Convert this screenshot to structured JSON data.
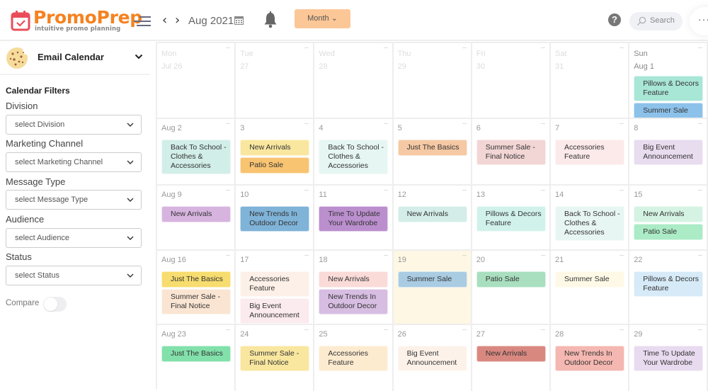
{
  "app": {
    "logo_title": "PromoPrep",
    "logo_subtitle": "intuitive promo planning",
    "brand_color": "#f5821f"
  },
  "header": {
    "current_month": "Aug 2021",
    "view_button": "Month ⌄",
    "search_label": "Search",
    "more_label": "···",
    "help_label": "?"
  },
  "sidebar": {
    "calendar_name": "Email Calendar",
    "filters_title": "Calendar Filters",
    "filters": [
      {
        "label": "Division",
        "placeholder": "select Division"
      },
      {
        "label": "Marketing Channel",
        "placeholder": "select Marketing Channel"
      },
      {
        "label": "Message Type",
        "placeholder": "select Message Type"
      },
      {
        "label": "Audience",
        "placeholder": "select Audience"
      },
      {
        "label": "Status",
        "placeholder": "select Status"
      }
    ],
    "compare_label": "Compare",
    "compare_on": false
  },
  "calendar": {
    "weeks": [
      {
        "days": [
          {
            "label": "Mon\nJul 26",
            "faded": true,
            "events": []
          },
          {
            "label": "Tue\n27",
            "faded": true,
            "events": []
          },
          {
            "label": "Wed\n28",
            "faded": true,
            "events": []
          },
          {
            "label": "Thu\n29",
            "faded": true,
            "events": []
          },
          {
            "label": "Fri\n30",
            "faded": true,
            "events": []
          },
          {
            "label": "Sat\n31",
            "faded": true,
            "events": []
          },
          {
            "label": "Sun\nAug 1",
            "faded": false,
            "events": [
              {
                "title": "Pillows & Decors Feature",
                "color": "#a8e6d6"
              },
              {
                "title": "Summer Sale",
                "color": "#8cc1ea"
              }
            ]
          }
        ]
      },
      {
        "days": [
          {
            "label": "Aug 2",
            "events": [
              {
                "title": "Back To School - Clothes & Accessories",
                "color": "#d2eee8"
              }
            ]
          },
          {
            "label": "3",
            "events": [
              {
                "title": "New Arrivals",
                "color": "#f9e79f"
              },
              {
                "title": "Patio Sale",
                "color": "#f8c471"
              }
            ]
          },
          {
            "label": "4",
            "events": [
              {
                "title": "Back To School - Clothes & Accessories",
                "color": "#e6f6f3"
              }
            ]
          },
          {
            "label": "5",
            "events": [
              {
                "title": "Just The Basics",
                "color": "#f5c9a4"
              }
            ]
          },
          {
            "label": "6",
            "events": [
              {
                "title": "Summer Sale - Final Notice",
                "color": "#f2d5d5"
              }
            ]
          },
          {
            "label": "7",
            "events": [
              {
                "title": "Accessories Feature",
                "color": "#fce9e9"
              }
            ]
          },
          {
            "label": "8",
            "events": [
              {
                "title": "Big Event Announcement",
                "color": "#e8dcef"
              }
            ]
          }
        ]
      },
      {
        "days": [
          {
            "label": "Aug 9",
            "events": [
              {
                "title": "New Arrivals",
                "color": "#d7b4e0"
              }
            ]
          },
          {
            "label": "10",
            "events": [
              {
                "title": "New Trends In Outdoor Decor",
                "color": "#7fb3d8"
              }
            ]
          },
          {
            "label": "11",
            "events": [
              {
                "title": "Time To Update Your Wardrobe",
                "color": "#bb8fce"
              }
            ]
          },
          {
            "label": "12",
            "events": [
              {
                "title": "New Arrivals",
                "color": "#d4ede8"
              }
            ]
          },
          {
            "label": "13",
            "events": [
              {
                "title": "Pillows & Decors Feature",
                "color": "#d1f2eb"
              }
            ]
          },
          {
            "label": "14",
            "events": [
              {
                "title": "Back To School - Clothes & Accessories",
                "color": "#e8f6f3"
              }
            ]
          },
          {
            "label": "15",
            "events": [
              {
                "title": "New Arrivals",
                "color": "#d5f3e3"
              },
              {
                "title": "Patio Sale",
                "color": "#abebc6"
              }
            ]
          }
        ]
      },
      {
        "days": [
          {
            "label": "Aug 16",
            "events": [
              {
                "title": "Just The Basics",
                "color": "#f7dc6f"
              },
              {
                "title": "Summer Sale - Final Notice",
                "color": "#fae5d3"
              }
            ]
          },
          {
            "label": "17",
            "events": [
              {
                "title": "Accessories Feature",
                "color": "#fdf0e8"
              },
              {
                "title": "Big Event Announcement",
                "color": "#fbeaee"
              }
            ]
          },
          {
            "label": "18",
            "events": [
              {
                "title": "New Arrivals",
                "color": "#fadbd8"
              },
              {
                "title": "New Trends In Outdoor Decor",
                "color": "#d7bde2"
              }
            ]
          },
          {
            "label": "19",
            "today": true,
            "events": [
              {
                "title": "Summer Sale",
                "color": "#a9cce3"
              }
            ]
          },
          {
            "label": "20",
            "events": [
              {
                "title": "Patio Sale",
                "color": "#a9dfbf"
              }
            ]
          },
          {
            "label": "21",
            "events": [
              {
                "title": "Summer Sale",
                "color": "#fef9e7"
              }
            ]
          },
          {
            "label": "22",
            "events": [
              {
                "title": "Pillows & Decors Feature",
                "color": "#d6eaf8"
              }
            ]
          }
        ]
      },
      {
        "days": [
          {
            "label": "Aug 23",
            "events": [
              {
                "title": "Just The Basics",
                "color": "#82e0aa"
              }
            ]
          },
          {
            "label": "24",
            "events": [
              {
                "title": "Summer Sale - Final Notice",
                "color": "#f9e79f"
              }
            ]
          },
          {
            "label": "25",
            "events": [
              {
                "title": "Accessories Feature",
                "color": "#fdebd0"
              }
            ]
          },
          {
            "label": "26",
            "events": [
              {
                "title": "Big Event Announcement",
                "color": "#fdf2e9"
              }
            ]
          },
          {
            "label": "27",
            "events": [
              {
                "title": "New Arrivals",
                "color": "#d98880"
              }
            ]
          },
          {
            "label": "28",
            "events": [
              {
                "title": "New Trends In Outdoor Decor",
                "color": "#f5b7b1"
              }
            ]
          },
          {
            "label": "29",
            "events": [
              {
                "title": "Time To Update Your Wardrobe",
                "color": "#e8daef"
              }
            ]
          }
        ]
      }
    ]
  }
}
